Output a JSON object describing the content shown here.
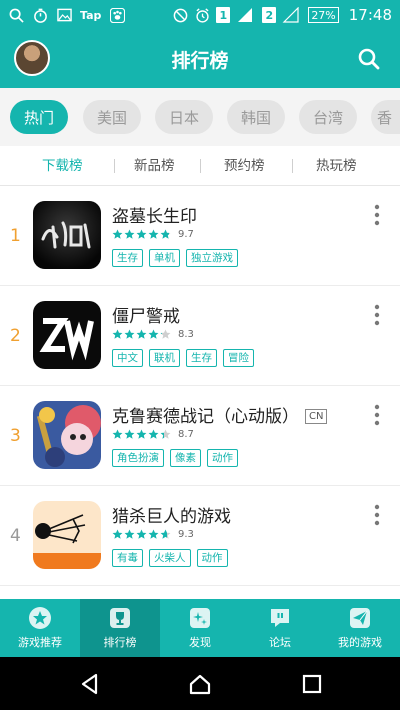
{
  "status_bar": {
    "carrier_label": "Tap",
    "sim1": "1",
    "sim2": "2",
    "network_label": "LTE",
    "battery": "27%",
    "time": "17:48"
  },
  "header": {
    "title": "排行榜"
  },
  "regions": [
    "热门",
    "美国",
    "日本",
    "韩国",
    "台湾",
    "香"
  ],
  "sub_tabs": [
    "下载榜",
    "新品榜",
    "预约榜",
    "热玩榜"
  ],
  "games": [
    {
      "rank": "1",
      "name": "盗墓长生印",
      "badge": "",
      "rating": 4.85,
      "score": "9.7",
      "tags": [
        "生存",
        "单机",
        "独立游戏"
      ]
    },
    {
      "rank": "2",
      "name": "僵尸警戒",
      "badge": "",
      "rating": 4.15,
      "score": "8.3",
      "tags": [
        "中文",
        "联机",
        "生存",
        "冒险"
      ]
    },
    {
      "rank": "3",
      "name": "克鲁赛德战记（心动版）",
      "badge": "CN",
      "rating": 4.35,
      "score": "8.7",
      "tags": [
        "角色扮演",
        "像素",
        "动作"
      ]
    },
    {
      "rank": "4",
      "name": "猎杀巨人的游戏",
      "badge": "",
      "rating": 4.65,
      "score": "9.3",
      "tags": [
        "有毒",
        "火柴人",
        "动作"
      ]
    }
  ],
  "bottom_nav": [
    "游戏推荐",
    "排行榜",
    "发现",
    "论坛",
    "我的游戏"
  ],
  "colors": {
    "accent": "#15b5ae",
    "rank_top": "#f0a030",
    "star": "#15b5ae"
  }
}
